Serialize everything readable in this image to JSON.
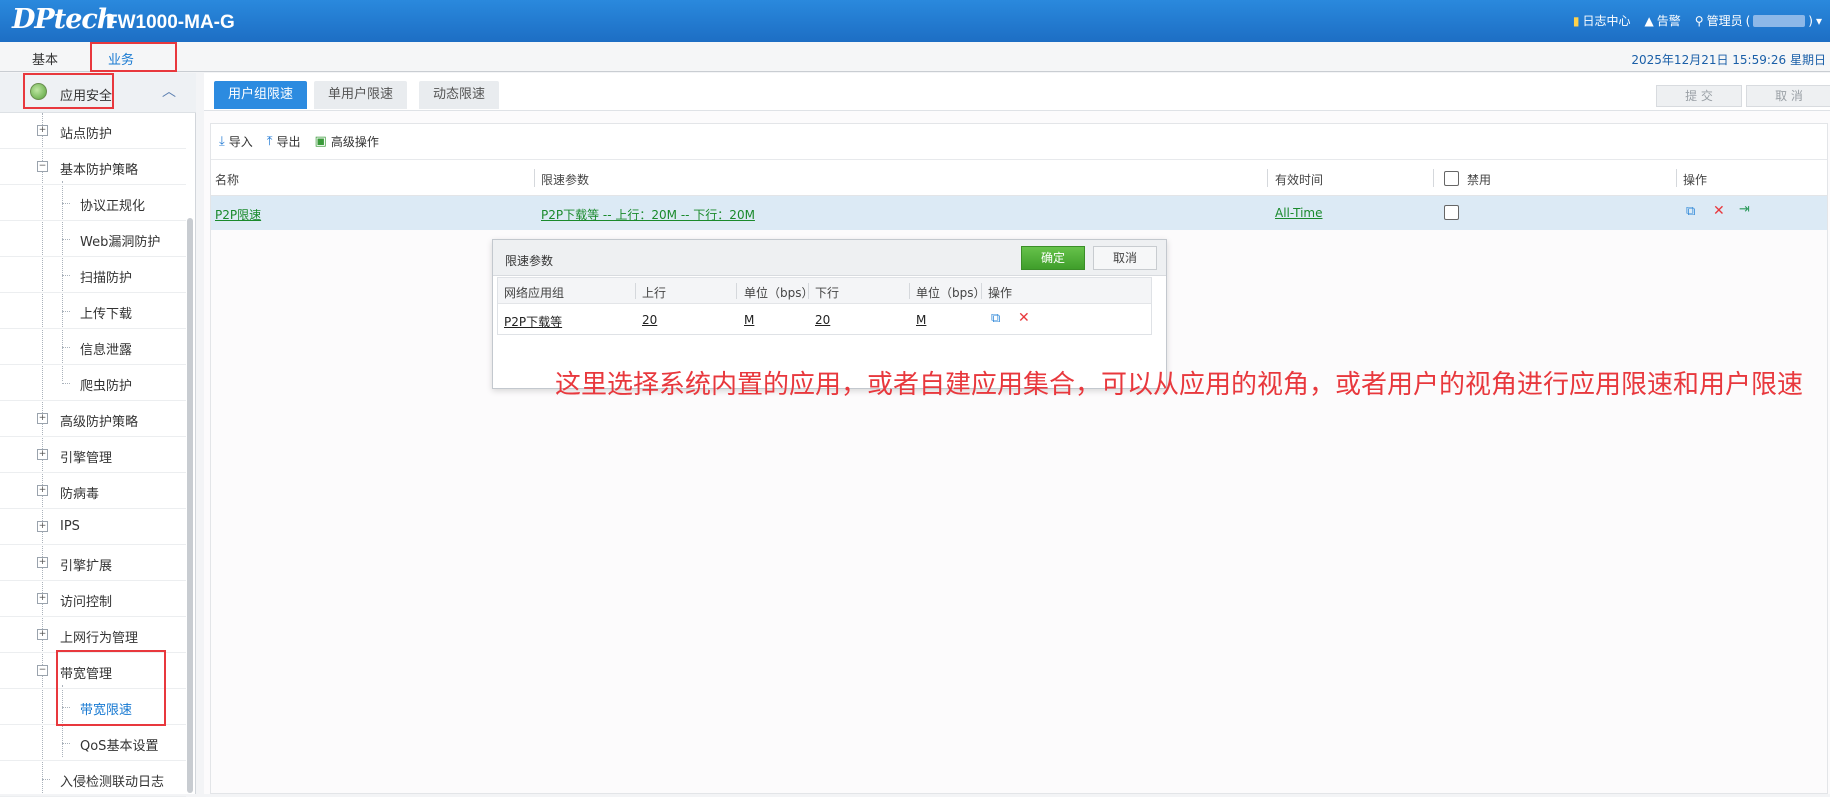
{
  "header": {
    "logo": "DPtech",
    "model": "FW1000-MA-G",
    "log_center": "日志中心",
    "alarm": "告警",
    "admin": "管理员"
  },
  "nav": {
    "tabs": [
      "基本",
      "业务"
    ],
    "datetime": "2025年12月21日  15:59:26  星期日"
  },
  "sidebar": {
    "section_title": "应用安全",
    "items": [
      {
        "label": "站点防护",
        "expander": "+"
      },
      {
        "label": "基本防护策略",
        "expander": "−"
      },
      {
        "label": "协议正规化"
      },
      {
        "label": "Web漏洞防护"
      },
      {
        "label": "扫描防护"
      },
      {
        "label": "上传下载"
      },
      {
        "label": "信息泄露"
      },
      {
        "label": "爬虫防护"
      },
      {
        "label": "高级防护策略",
        "expander": "+"
      },
      {
        "label": "引擎管理",
        "expander": "+"
      },
      {
        "label": "防病毒",
        "expander": "+"
      },
      {
        "label": "IPS",
        "expander": "+"
      },
      {
        "label": "引擎扩展",
        "expander": "+"
      },
      {
        "label": "访问控制",
        "expander": "+"
      },
      {
        "label": "上网行为管理",
        "expander": "+"
      },
      {
        "label": "带宽管理",
        "expander": "−"
      },
      {
        "label": "带宽限速"
      },
      {
        "label": "QoS基本设置"
      },
      {
        "label": "入侵检测联动日志"
      }
    ]
  },
  "main": {
    "tabs": [
      "用户组限速",
      "单用户限速",
      "动态限速"
    ],
    "submit": "提 交",
    "cancel": "取 消",
    "toolbar": {
      "import": "导入",
      "export": "导出",
      "advanced": "高级操作"
    },
    "columns": {
      "name": "名称",
      "params": "限速参数",
      "time": "有效时间",
      "disable": "禁用",
      "ops": "操作"
    },
    "row": {
      "name": "P2P限速",
      "params": "P2P下载等 -- 上行：20M -- 下行：20M",
      "time": "All-Time"
    }
  },
  "popup": {
    "title": "限速参数",
    "ok": "确定",
    "cancel": "取消",
    "columns": {
      "group": "网络应用组",
      "up": "上行",
      "unit1": "单位（bps）",
      "down": "下行",
      "unit2": "单位（bps）",
      "ops": "操作"
    },
    "row": {
      "group": "P2P下载等",
      "up": "20",
      "unit1": "M",
      "down": "20",
      "unit2": "M"
    }
  },
  "annotation": "这里选择系统内置的应用，或者自建应用集合，可以从应用的视角，或者用户的视角进行应用限速和用户限速",
  "colors": {
    "header": "#1d6ec4",
    "active_tab": "#2c8be0",
    "link": "#1a8a2c",
    "annotation": "#e8383d",
    "ok_button": "#4ea835"
  }
}
